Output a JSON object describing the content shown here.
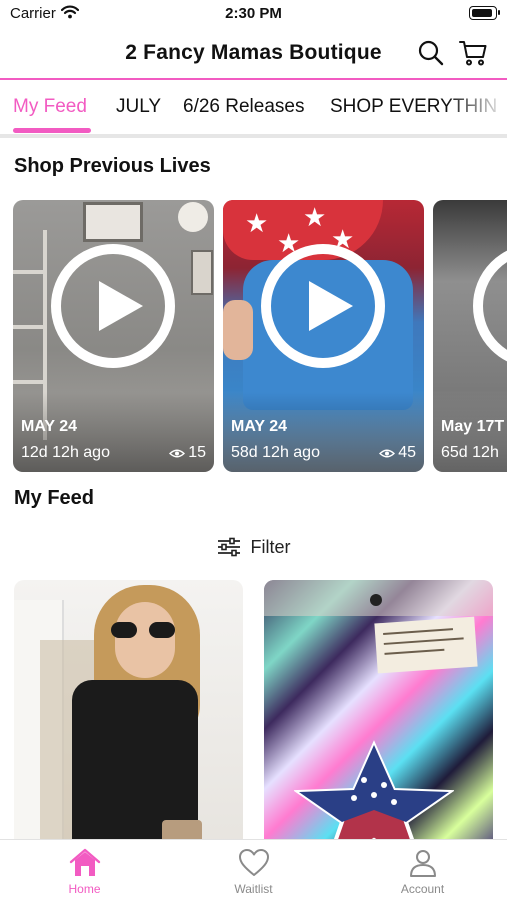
{
  "status_bar": {
    "carrier": "Carrier",
    "time": "2:30 PM"
  },
  "header": {
    "title": "2 Fancy Mamas Boutique"
  },
  "tabs": [
    {
      "label": "My Feed",
      "active": true
    },
    {
      "label": "JULY"
    },
    {
      "label": "6/26 Releases"
    },
    {
      "label": "SHOP EVERYTHIN"
    }
  ],
  "lives": {
    "title": "Shop Previous Lives",
    "items": [
      {
        "date": "MAY 24",
        "ago": "12d 12h ago",
        "views": "15"
      },
      {
        "date": "MAY 24",
        "ago": "58d 12h ago",
        "views": "45"
      },
      {
        "date": "May 17T",
        "ago": "65d 12h"
      }
    ]
  },
  "feed": {
    "title": "My Feed",
    "filter_label": "Filter"
  },
  "bottom_nav": [
    {
      "label": "Home",
      "icon": "home-icon",
      "active": true
    },
    {
      "label": "Waitlist",
      "icon": "heart-icon"
    },
    {
      "label": "Account",
      "icon": "person-icon"
    }
  ],
  "colors": {
    "accent": "#f25bc2",
    "inactive": "#8a8a8a"
  }
}
